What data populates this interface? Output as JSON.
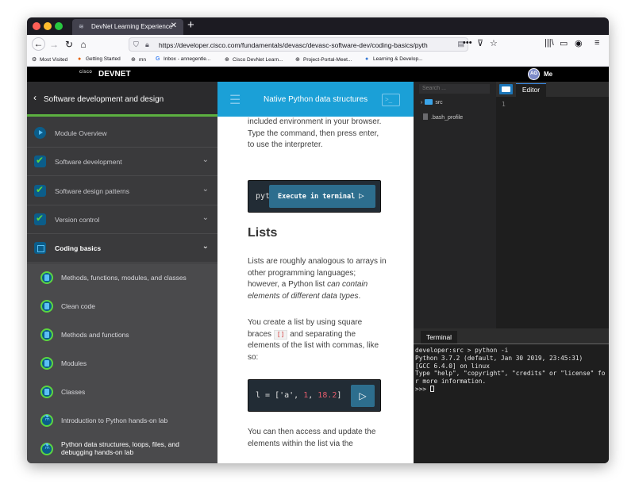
{
  "browser": {
    "tab_title": "DevNet Learning Experience",
    "url": "https://developer.cisco.com/fundamentals/devasc/devasc-software-dev/coding-basics/pyth",
    "new_tab": "+"
  },
  "bookmarks": [
    {
      "label": "Most Visited",
      "icon": "gear-icon"
    },
    {
      "label": "Getting Started",
      "icon": "firefox-icon"
    },
    {
      "label": "mn",
      "icon": "globe-icon"
    },
    {
      "label": "Inbox - annegentle...",
      "icon": "google-icon"
    },
    {
      "label": "Cisco DevNet Learn...",
      "icon": "globe-icon"
    },
    {
      "label": "Project-Portal-Meet...",
      "icon": "globe-icon"
    },
    {
      "label": "Learning & Develop...",
      "icon": "globe-icon"
    }
  ],
  "header": {
    "cisco": "cisco",
    "devnet": "DEVNET",
    "avatar_initials": "AG",
    "user": "Me"
  },
  "sidebar": {
    "title": "Software development and design",
    "items": [
      {
        "label": "Module Overview",
        "icon": "play-icon"
      },
      {
        "label": "Software development",
        "icon": "check-icon"
      },
      {
        "label": "Software design patterns",
        "icon": "check-icon"
      },
      {
        "label": "Version control",
        "icon": "check-icon"
      },
      {
        "label": "Coding basics",
        "icon": "book-icon"
      }
    ],
    "subitems": [
      {
        "label": "Methods, functions, modules, and classes"
      },
      {
        "label": "Clean code"
      },
      {
        "label": "Methods and functions"
      },
      {
        "label": "Modules"
      },
      {
        "label": "Classes"
      },
      {
        "label": "Introduction to Python hands-on lab"
      },
      {
        "label": "Python data structures, loops, files, and debugging hands-on lab"
      }
    ]
  },
  "content": {
    "title": "Native Python data structures",
    "intro": "included environment in your browser. Type the command, then press enter, to use the interpreter.",
    "code1_prefix": "pyth",
    "execute_label": "Execute in terminal",
    "heading_lists": "Lists",
    "p1_start": "Lists are roughly analogous to arrays in other programming languages; however, a Python list ",
    "p1_em": "can contain elements of different data types",
    "p1_end": ".",
    "p2_start": "You create a list by using square braces ",
    "p2_code": "[]",
    "p2_end": " and separating the elements of the list with commas, like so:",
    "code2": {
      "a": "l = [",
      "b": "'a'",
      "c": ", ",
      "d": "1",
      "e": ", ",
      "f": "18.2",
      "g": "]"
    },
    "p3": "You can then access and update the elements within the list via the"
  },
  "ide": {
    "search_placeholder": "Search ...",
    "tree": [
      {
        "label": "src",
        "type": "folder"
      },
      {
        "label": ".bash_profile",
        "type": "file"
      }
    ],
    "editor_tab": "Editor",
    "line_number": "1",
    "terminal_tab": "Terminal",
    "terminal_lines": [
      "developer:src > python -i",
      "Python 3.7.2 (default, Jan 30 2019, 23:45:31)",
      "[GCC 6.4.0] on linux",
      "Type \"help\", \"copyright\", \"credits\" or \"license\" fo",
      "r more information.",
      ">>> "
    ]
  }
}
